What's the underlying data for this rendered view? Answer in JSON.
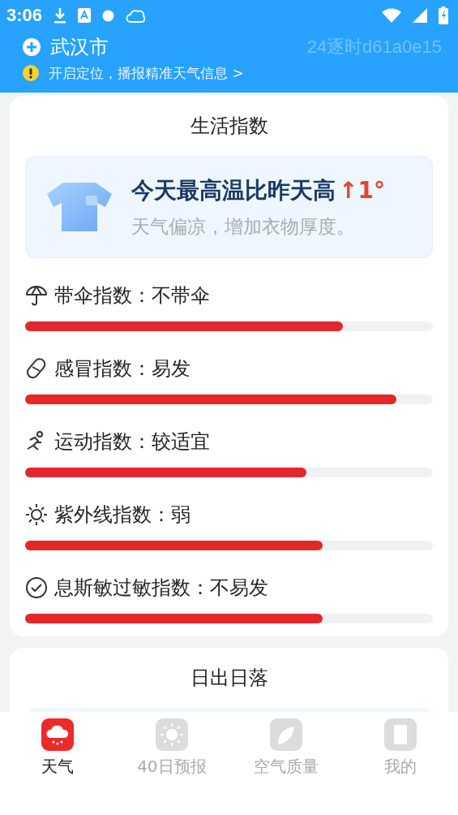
{
  "status_bar": {
    "time": "3:06"
  },
  "header": {
    "city": "武汉市",
    "code": "24逐时d61a0e15",
    "notice": "开启定位，播报精准天气信息 >"
  },
  "life_index": {
    "title": "生活指数",
    "tip": {
      "headline": "今天最高温比昨天高",
      "change": "↑1°",
      "advice": "天气偏凉，增加衣物厚度。"
    },
    "items": [
      {
        "kind": "umbrella",
        "label": "带伞指数：不带伞",
        "level": 0.78
      },
      {
        "kind": "cold",
        "label": "感冒指数：易发",
        "level": 0.91
      },
      {
        "kind": "sport",
        "label": "运动指数：较适宜",
        "level": 0.69
      },
      {
        "kind": "uv",
        "label": "紫外线指数：弱",
        "level": 0.73
      },
      {
        "kind": "allergy",
        "label": "息斯敏过敏指数：不易发",
        "level": 0.73
      }
    ]
  },
  "sun_card": {
    "title": "日出日落"
  },
  "tabs": [
    {
      "kind": "weather",
      "label": "天气",
      "selected": true
    },
    {
      "kind": "forecast",
      "label": "40日预报",
      "selected": false
    },
    {
      "kind": "air",
      "label": "空气质量",
      "selected": false
    },
    {
      "kind": "mine",
      "label": "我的",
      "selected": false
    }
  ]
}
